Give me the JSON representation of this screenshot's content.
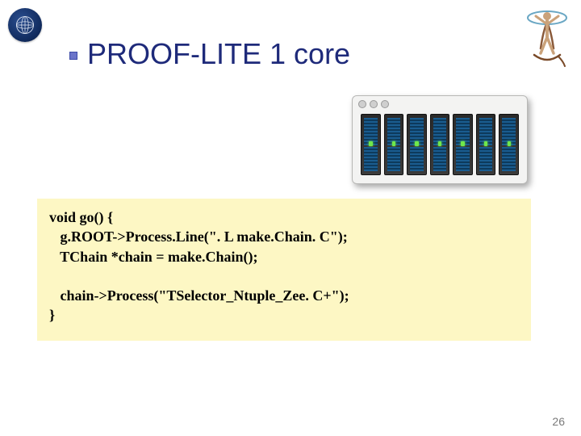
{
  "title": "PROOF-LITE  1 core",
  "page_number": "26",
  "code": {
    "l1": "void go() {",
    "l2": "   g.ROOT->Process.Line(\". L make.Chain. C\");",
    "l3": "   TChain *chain = make.Chain();",
    "l4": "",
    "l5": "   chain->Process(\"TSelector_Ntuple_Zee. C+\");",
    "l6": "}"
  }
}
